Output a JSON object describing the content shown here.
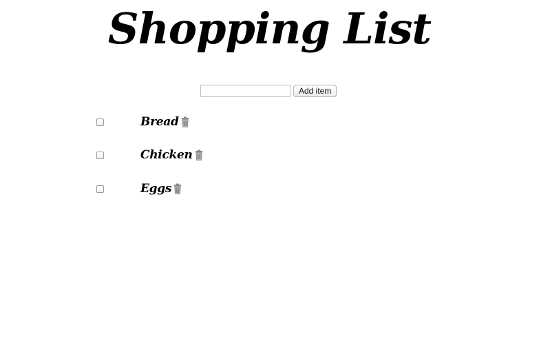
{
  "header": {
    "title": "Shopping List"
  },
  "add_form": {
    "input_value": "",
    "input_placeholder": "",
    "button_label": "Add item"
  },
  "items": [
    {
      "label": "Bread",
      "checked": false,
      "delete_icon": "trash-icon"
    },
    {
      "label": "Chicken",
      "checked": false,
      "delete_icon": "trash-icon"
    },
    {
      "label": "Eggs",
      "checked": false,
      "delete_icon": "trash-icon"
    }
  ],
  "colors": {
    "text": "#000000",
    "background": "#ffffff",
    "icon": "#8a8a8a"
  }
}
